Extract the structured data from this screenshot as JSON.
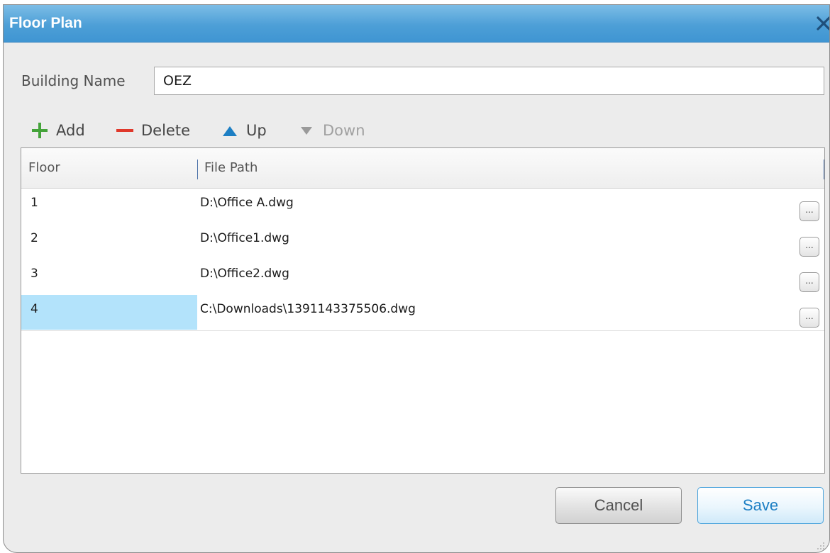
{
  "dialog": {
    "title": "Floor Plan"
  },
  "building": {
    "label": "Building Name",
    "value": "OEZ"
  },
  "toolbar": {
    "add_label": "Add",
    "delete_label": "Delete",
    "up_label": "Up",
    "down_label": "Down"
  },
  "grid": {
    "columns": [
      "Floor",
      "File Path"
    ],
    "browse_label": "...",
    "rows": [
      {
        "floor": "1",
        "path": "D:\\Office A.dwg"
      },
      {
        "floor": "2",
        "path": "D:\\Office1.dwg"
      },
      {
        "floor": "3",
        "path": "D:\\Office2.dwg"
      },
      {
        "floor": "4",
        "path": "C:\\Downloads\\1391143375506.dwg"
      }
    ],
    "selected_row": 4
  },
  "buttons": {
    "cancel": "Cancel",
    "save": "Save"
  },
  "colors": {
    "title_bar": "#4d9fd7",
    "add_icon": "#44a33a",
    "delete_icon": "#e0382b",
    "up_icon": "#1d7fc4",
    "down_icon": "#9a9a9a",
    "selected_cell": "#b3e3fb"
  }
}
